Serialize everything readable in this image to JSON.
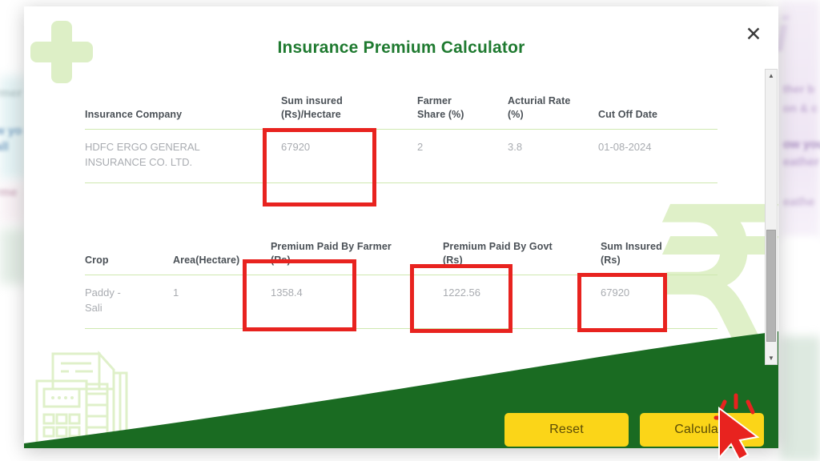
{
  "modal": {
    "title": "Insurance Premium Calculator",
    "close_icon": "close-icon"
  },
  "insurance_table": {
    "headers": [
      "Insurance Company",
      "Sum insured (Rs)/Hectare",
      "Farmer Share (%)",
      "Acturial Rate (%)",
      "Cut Off Date"
    ],
    "header_lines": {
      "company": "Insurance Company",
      "sum_insured_l1": "Sum insured",
      "sum_insured_l2": "(Rs)/Hectare",
      "farmer_share_l1": "Farmer",
      "farmer_share_l2": "Share (%)",
      "acturial_l1": "Acturial Rate",
      "acturial_l2": "(%)",
      "cut_off": "Cut Off Date"
    },
    "rows": [
      {
        "company_l1": "HDFC ERGO GENERAL",
        "company_l2": "INSURANCE CO. LTD.",
        "sum_insured_per_hectare": "67920",
        "farmer_share": "2",
        "acturial_rate": "3.8",
        "cut_off_date": "01-08-2024"
      }
    ]
  },
  "premium_table": {
    "header_lines": {
      "crop": "Crop",
      "area": "Area(Hectare)",
      "premium_farmer_l1": "Premium Paid By Farmer",
      "premium_farmer_l2": "(Rs)",
      "premium_govt_l1": "Premium Paid By Govt",
      "premium_govt_l2": "(Rs)",
      "sum_insured_l1": "Sum Insured",
      "sum_insured_l2": "(Rs)"
    },
    "rows": [
      {
        "crop_l1": "Paddy -",
        "crop_l2": "Sali",
        "area": "1",
        "premium_paid_by_farmer": "1358.4",
        "premium_paid_by_govt": "1222.56",
        "sum_insured": "67920"
      }
    ]
  },
  "actions": {
    "reset_label": "Reset",
    "calculate_label": "Calculate"
  },
  "watermarks": {
    "rupee_symbol": "₹"
  },
  "scrollbar": {
    "up_arrow": "▲",
    "down_arrow": "▼"
  },
  "background_text": {
    "left_1": "rmer",
    "left_2": "w yo",
    "left_3": "all",
    "left_4": "rme",
    "right_logo": "i",
    "right_1": "ther b",
    "right_2": "on & c",
    "right_3": "ow you",
    "right_4": "eather",
    "right_5": "eathe"
  },
  "colors": {
    "brand_green": "#1f7a30",
    "accent_yellow": "#fbd518",
    "highlight_red": "#e8231f",
    "table_rule_green": "#cfe8b0"
  }
}
